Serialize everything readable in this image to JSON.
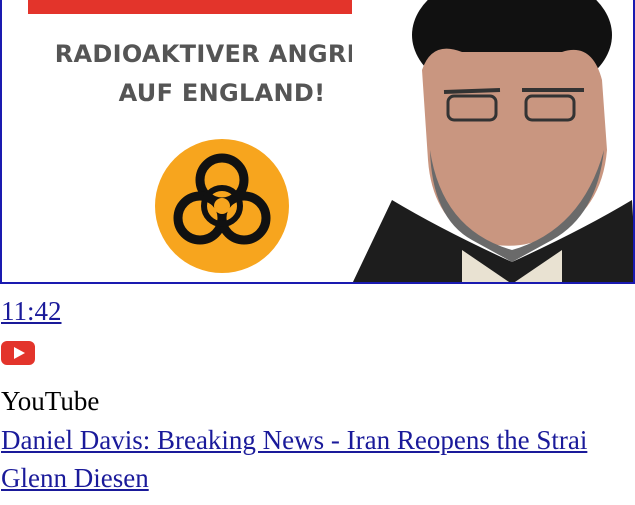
{
  "thumbnail": {
    "banner_text": "",
    "caption_line1": "RADIOAKTIVER ANGRIFF",
    "caption_line2": "AUF ENGLAND!",
    "hazard_icon": "biohazard-icon",
    "colors": {
      "banner_red": "#e3342b",
      "hazard_orange": "#f7a51e",
      "border_blue": "#1a1ab0"
    }
  },
  "video": {
    "duration": "11:42",
    "platform_icon": "youtube-icon",
    "source": "YouTube",
    "title": "Daniel Davis: Breaking News - Iran Reopens the Strai",
    "channel": "Glenn Diesen"
  }
}
